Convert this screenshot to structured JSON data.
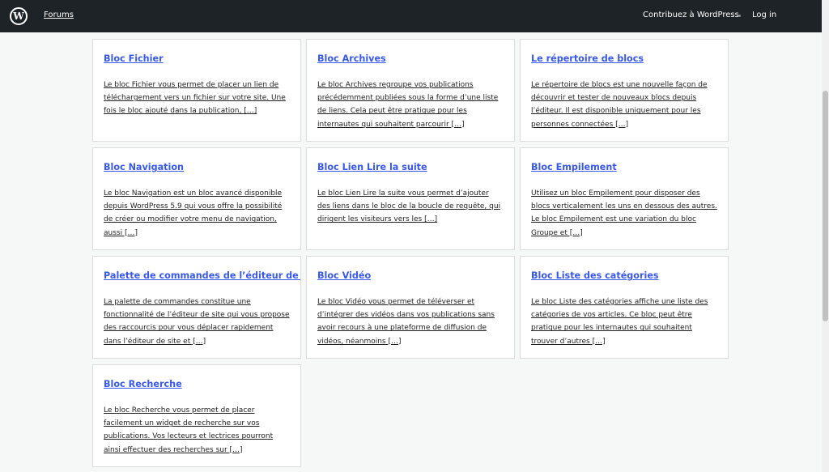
{
  "header": {
    "logo_letter": "W",
    "forums_label": "Forums",
    "contribute_label": "Contribuez à WordPress",
    "login_label": "Log in"
  },
  "cards": [
    {
      "title": "Bloc Fichier",
      "excerpt": "Le bloc Fichier vous permet de placer un lien de téléchargement vers un fichier sur votre site. Une fois le bloc ajouté dans la publication, […]"
    },
    {
      "title": "Bloc Archives",
      "excerpt": "Le bloc Archives regroupe vos publications précédemment publiées sous la forme d’une liste de liens. Cela peut être pratique pour les internautes qui souhaitent parcourir […]"
    },
    {
      "title": "Le répertoire de blocs",
      "excerpt": "Le répertoire de blocs est une nouvelle façon de découvrir et tester de nouveaux blocs depuis l’éditeur. Il est disponible uniquement pour les personnes connectées […]"
    },
    {
      "title": "Bloc Navigation",
      "excerpt": "Le bloc Navigation est un bloc avancé disponible depuis WordPress 5.9 qui vous offre la possibilité de créer ou modifier votre menu de navigation, aussi […]"
    },
    {
      "title": "Bloc Lien Lire la suite",
      "excerpt": "Le bloc Lien Lire la suite vous permet d’ajouter des liens dans le bloc de la boucle de requête, qui dirigent les visiteurs vers les […]"
    },
    {
      "title": "Bloc Empilement",
      "excerpt": "Utilisez un bloc Empilement pour disposer des blocs verticalement les uns en dessous des autres. Le bloc Empilement est une variation du bloc Groupe et […]"
    },
    {
      "title": "Palette de commandes de l’éditeur de site",
      "excerpt": "La palette de commandes constitue une fonctionnalité de l’éditeur de site qui vous propose des raccourcis pour vous déplacer rapidement dans l’éditeur de site et […]"
    },
    {
      "title": "Bloc Vidéo",
      "excerpt": "Le bloc Vidéo vous permet de téléverser et d’intégrer des vidéos dans vos publications sans avoir recours à une plateforme de diffusion de vidéos, néanmoins […]"
    },
    {
      "title": "Bloc Liste des catégories",
      "excerpt": "Le bloc Liste des catégories affiche une liste des catégories de vos articles. Ce bloc peut être pratique pour les internautes qui souhaitent trouver d’autres […]"
    },
    {
      "title": "Bloc Recherche",
      "excerpt": "Le bloc Recherche vous permet de placer facilement un widget de recherche sur vos publications. Vos lecteurs et lectrices pourront ainsi effectuer des recherches sur […]"
    }
  ],
  "colors": {
    "topbar": "#1d2327",
    "link": "#3858e9",
    "background": "#f6f7f7"
  }
}
